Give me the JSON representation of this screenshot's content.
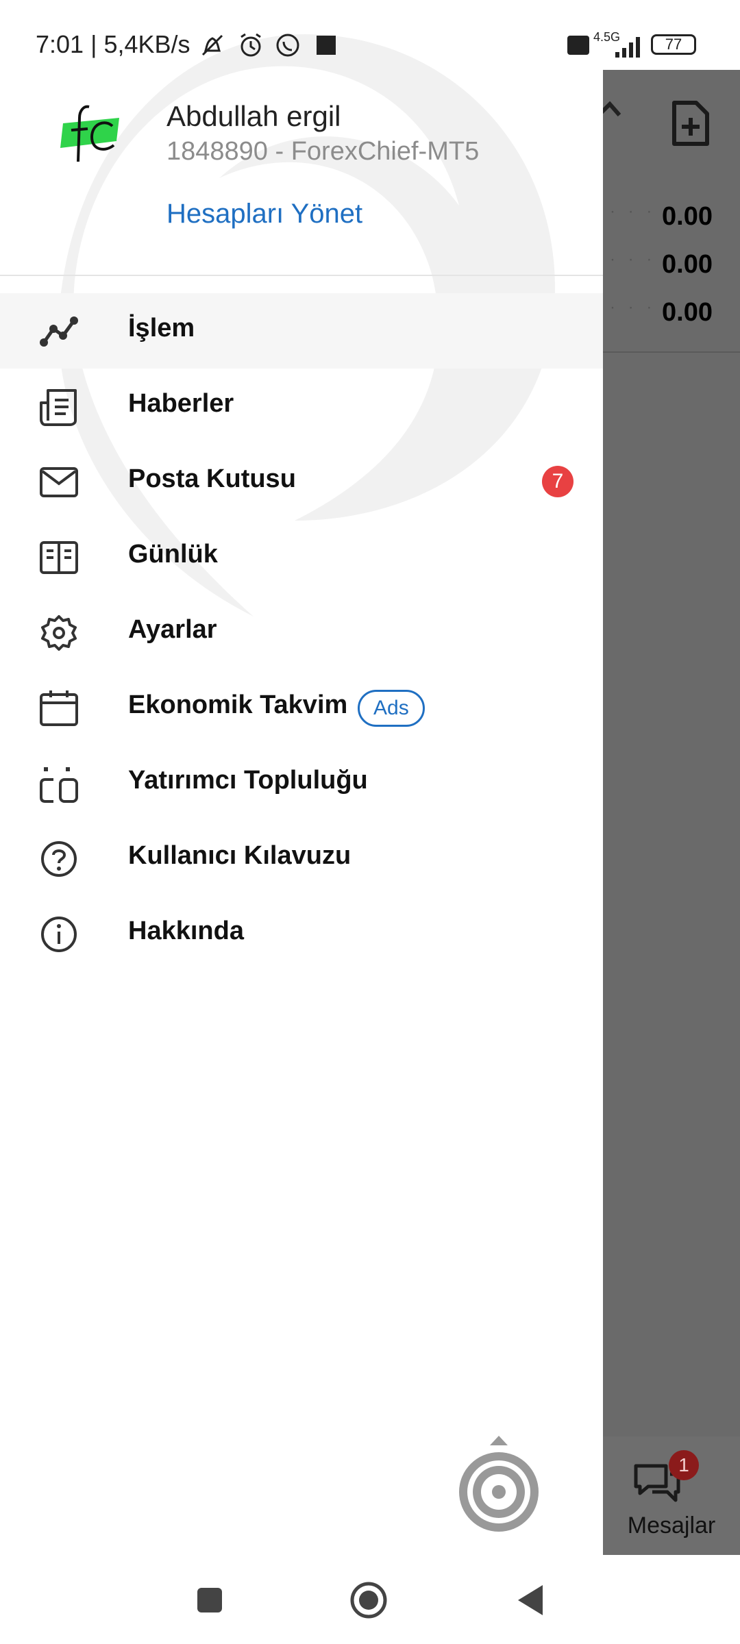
{
  "status_bar": {
    "time": "7:01",
    "speed": "5,4KB/s",
    "network": "4.5G",
    "battery": "77"
  },
  "background": {
    "values": [
      "0.00",
      "0.00",
      "0.00"
    ],
    "messages_label": "Mesajlar",
    "messages_badge": "1"
  },
  "drawer": {
    "account_name": "Abdullah ergil",
    "account_id": "1848890 - ForexChief-MT5",
    "manage_accounts": "Hesapları Yönet",
    "menu": [
      {
        "label": "İşlem",
        "icon": "trade-chart-icon",
        "active": true
      },
      {
        "label": "Haberler",
        "icon": "news-icon"
      },
      {
        "label": "Posta Kutusu",
        "icon": "mail-icon",
        "badge": "7"
      },
      {
        "label": "Günlük",
        "icon": "journal-icon"
      },
      {
        "label": "Ayarlar",
        "icon": "gear-icon"
      },
      {
        "label": "Ekonomik Takvim",
        "icon": "calendar-icon",
        "tag": "Ads"
      },
      {
        "label": "Yatırımcı Topluluğu",
        "icon": "community-icon"
      },
      {
        "label": "Kullanıcı Kılavuzu",
        "icon": "help-icon"
      },
      {
        "label": "Hakkında",
        "icon": "info-icon"
      }
    ]
  },
  "colors": {
    "accent": "#1f6fc2",
    "badge": "#e84142",
    "scrim": "#6a6a6a",
    "logo_green": "#2fd34a"
  }
}
